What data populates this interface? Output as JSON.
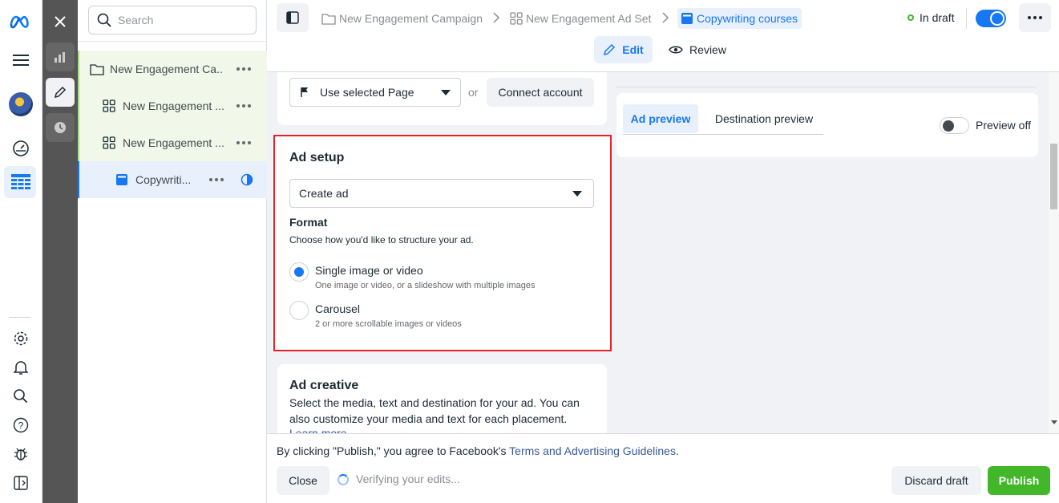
{
  "tree": {
    "search_placeholder": "Search",
    "items": [
      {
        "label": "New Engagement Ca..."
      },
      {
        "label": "New Engagement ..."
      },
      {
        "label": "New Engagement ..."
      },
      {
        "label": "Copywriti..."
      }
    ]
  },
  "header": {
    "breadcrumbs": [
      "New Engagement Campaign",
      "New Engagement Ad Set",
      "Copywriting courses"
    ],
    "status": "In draft",
    "tabs": [
      {
        "label": "Edit"
      },
      {
        "label": "Review"
      }
    ]
  },
  "identity": {
    "page_select": "Use selected Page",
    "or": "or",
    "connect": "Connect account"
  },
  "ad_setup": {
    "title": "Ad setup",
    "select": "Create ad",
    "format_title": "Format",
    "format_desc": "Choose how you'd like to structure your ad.",
    "options": [
      {
        "label": "Single image or video",
        "desc": "One image or video, or a slideshow with multiple images",
        "selected": true
      },
      {
        "label": "Carousel",
        "desc": "2 or more scrollable images or videos",
        "selected": false
      }
    ]
  },
  "ad_creative": {
    "title": "Ad creative",
    "desc": "Select the media, text and destination for your ad. You can also customize your media and text for each placement.",
    "link": "Learn more"
  },
  "preview": {
    "tabs": [
      {
        "label": "Ad preview"
      },
      {
        "label": "Destination preview"
      }
    ],
    "toggle_label": "Preview off"
  },
  "footer": {
    "agree_prefix": "By clicking \"Publish,\" you agree to Facebook's ",
    "agree_link": "Terms and Advertising Guidelines",
    "agree_suffix": ".",
    "close": "Close",
    "verifying": "Verifying your edits...",
    "discard": "Discard draft",
    "publish": "Publish"
  },
  "colors": {
    "accent": "#1877f2",
    "publish": "#42b72a",
    "highlight_border": "#e0242c",
    "rail": "#555555",
    "tree_active": "#f1f8e9"
  }
}
